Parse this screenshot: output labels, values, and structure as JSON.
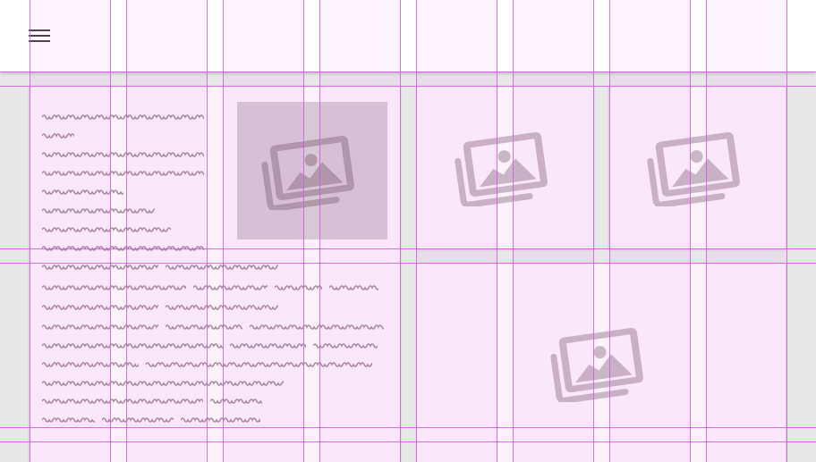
{
  "app_bar": {
    "menu_icon": "hamburger-menu-icon"
  },
  "colors": {
    "background": "#e8e8e8",
    "app_bar": "#ffffff",
    "card": "#fdf1fb",
    "image_selected_bg": "#d8c7d6",
    "placeholder_icon": "#c9b6c6",
    "placeholder_icon_selected": "#b09aaa",
    "text_placeholder": "#a98ca4",
    "grid_line": "#d25be0"
  },
  "cards": [
    {
      "kind": "text-with-image",
      "image_icon": "image-placeholder-icon",
      "image_selected": true
    },
    {
      "kind": "image",
      "image_icon": "image-placeholder-icon"
    },
    {
      "kind": "image",
      "image_icon": "image-placeholder-icon"
    },
    {
      "kind": "image",
      "image_icon": "image-placeholder-icon"
    }
  ]
}
